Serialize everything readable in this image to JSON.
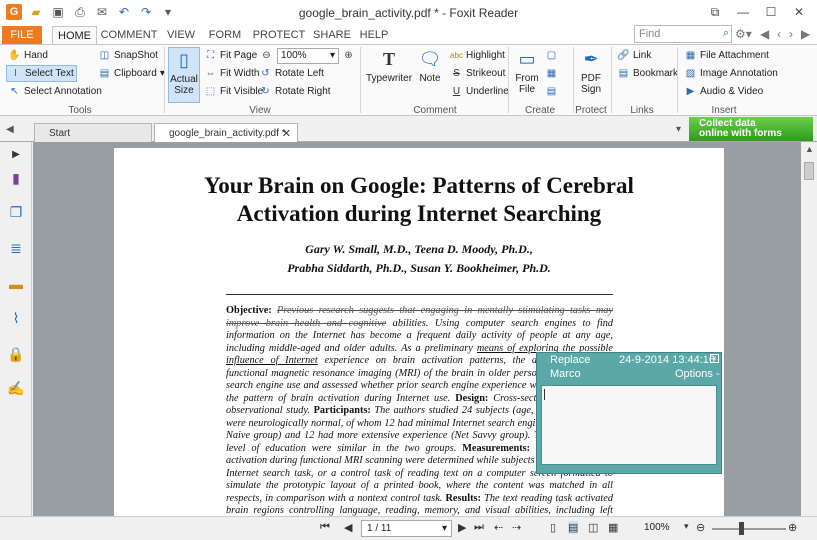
{
  "window": {
    "title": "google_brain_activity.pdf * - Foxit Reader"
  },
  "quick_access": [
    "app-icon",
    "open-icon",
    "save-icon",
    "print-icon",
    "email-icon",
    "undo-icon",
    "redo-icon",
    "customize-icon"
  ],
  "ribbon_tabs": {
    "file": "FILE",
    "home": "HOME",
    "comment": "COMMENT",
    "view": "VIEW",
    "form": "FORM",
    "protect": "PROTECT",
    "share": "SHARE",
    "help": "HELP"
  },
  "find": {
    "placeholder": "Find"
  },
  "tools": {
    "hand": "Hand",
    "select_text": "Select Text",
    "select_annotation": "Select Annotation",
    "snapshot": "SnapShot",
    "clipboard": "Clipboard",
    "group": "Tools"
  },
  "view": {
    "actual_size": "Actual Size",
    "fit_page": "Fit Page",
    "fit_width": "Fit Width",
    "fit_visible": "Fit Visible",
    "zoom": "100%",
    "rotate_left": "Rotate Left",
    "rotate_right": "Rotate Right",
    "group": "View"
  },
  "comment": {
    "typewriter": "Typewriter",
    "note": "Note",
    "highlight": "Highlight",
    "strikeout": "Strikeout",
    "underline": "Underline",
    "group": "Comment"
  },
  "create": {
    "from_file": "From File",
    "group": "Create"
  },
  "protect": {
    "pdf_sign": "PDF Sign",
    "group": "Protect"
  },
  "links": {
    "link": "Link",
    "bookmark": "Bookmark",
    "group": "Links"
  },
  "insert": {
    "file_attachment": "File Attachment",
    "image_annotation": "Image Annotation",
    "audio_video": "Audio & Video",
    "group": "Insert"
  },
  "doc_tabs": {
    "start": "Start",
    "active": "google_brain_activity.pdf *"
  },
  "ad": {
    "line1": "Collect data",
    "line2": "online with forms"
  },
  "page": {
    "title_line1": "Your Brain on Google: Patterns of Cerebral",
    "title_line2": "Activation during Internet Searching",
    "authors_line1": "Gary W. Small, M.D., Teena D. Moody, Ph.D.,",
    "authors_line2": "Prabha Siddarth, Ph.D., Susan Y. Bookheimer, Ph.D.",
    "objective_label": "Objective:",
    "objective_strike": "Previous research suggests that engaging in mentally stimulating tasks may improve brain health and cognitive",
    "objective_text1": " abilities. Using computer search engines to find information on the Internet has become a frequent daily activity of people at any age, including middle-aged and older adults. As a preliminary ",
    "objective_underline": "means of exploring the possible influence of Internet",
    "objective_text2": " experience on brain activation patterns, the authors performed functional magnetic resonance imaging (MRI) of the brain in older persons during Internet search engine use and assessed whether prior search engine experience was associated with the pattern of brain activation during Internet use. ",
    "design_label": "Design:",
    "design_text": " Cross-sectional, exploratory observational study. ",
    "participants_label": "Participants:",
    "participants_text": " The authors studied 24 subjects (age, 55–76 years) who were neurologically normal, of whom 12 had minimal Internet search engine experience (Net Naive group) and 12 had more extensive experience (Net Savvy group). The mean age and level of education were similar in the two groups. ",
    "measurements_label": "Measurements:",
    "measurements_text": " Patterns of brain activation during functional MRI scanning were determined while subjects performed a novel Internet search task, or a control task of reading text on a computer screen formatted to simulate the prototypic layout of a printed book, where the content was matched in all respects, in comparison with a nontext control task. ",
    "results_label": "Results:",
    "results_text": " The text reading task activated brain regions controlling language, reading, memory, and visual abilities, including left inferior frontal, temporal, posterior cingulate, parietal, and occipital regions, and both the Net Savvy and Net Naive groups showed similar patterns of activation."
  },
  "note_popup": {
    "type": "Replace",
    "timestamp": "24-9-2014 13:44:16",
    "author": "Marco",
    "options": "Options -"
  },
  "status": {
    "page": "1 / 11",
    "zoom": "100%"
  }
}
